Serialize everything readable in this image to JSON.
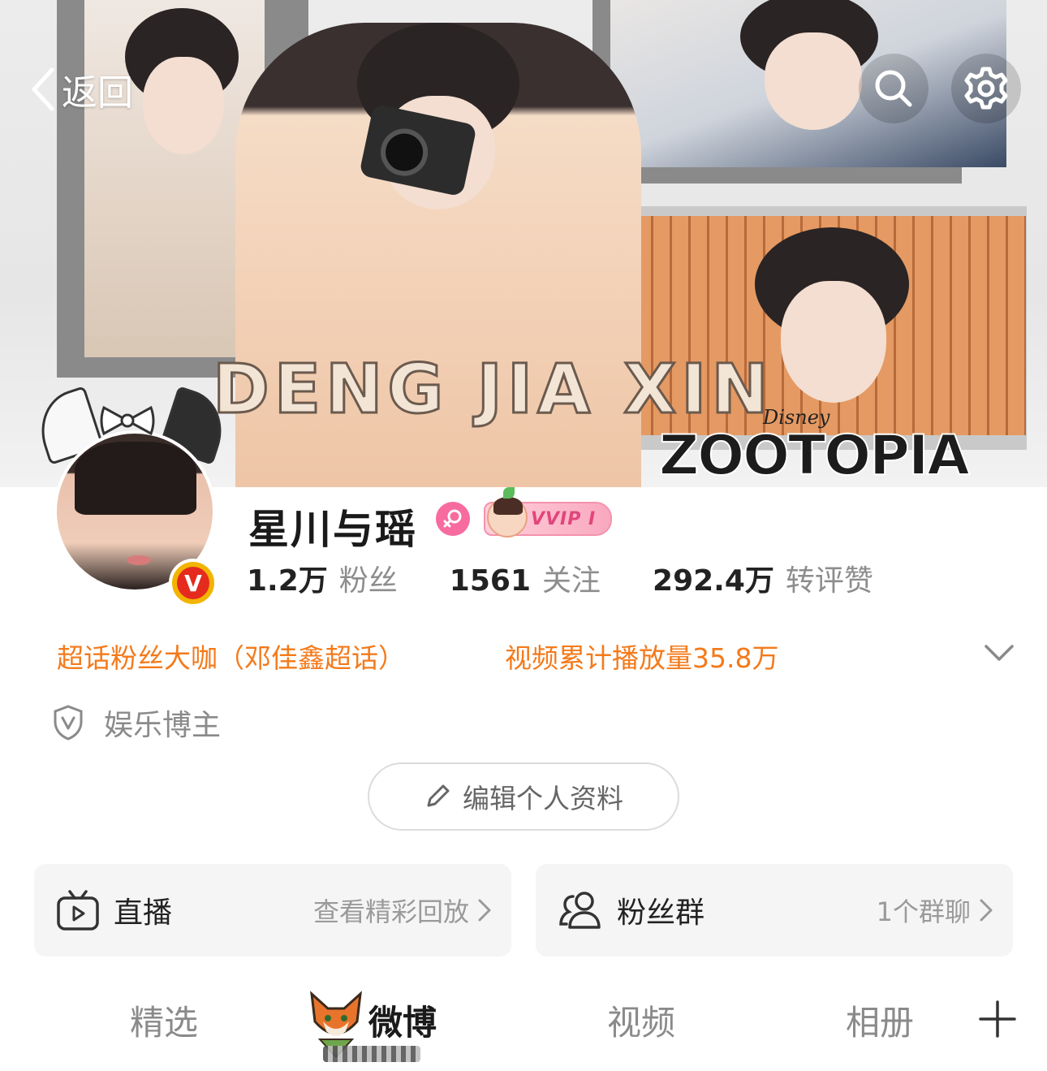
{
  "top_bar": {
    "back_label": "返回"
  },
  "cover": {
    "title_text": "DENG JIA XIN",
    "logo_small": "Disney",
    "logo_big": "ZOOTOPIA"
  },
  "profile": {
    "name": "星川与瑶",
    "gender": "female",
    "vip_badge": "VVIP I",
    "verified_badge": "V",
    "stats": [
      {
        "value": "1.2万",
        "label": "粉丝"
      },
      {
        "value": "1561",
        "label": "关注"
      },
      {
        "value": "292.4万",
        "label": "转评赞"
      }
    ],
    "tags": [
      "超话粉丝大咖（邓佳鑫超话）",
      "视频累计播放量35.8万"
    ],
    "category": "娱乐博主",
    "edit_button": "编辑个人资料"
  },
  "cards": {
    "live": {
      "title": "直播",
      "subtitle": "查看精彩回放"
    },
    "fans_group": {
      "title": "粉丝群",
      "subtitle": "1个群聊"
    }
  },
  "tabs": [
    {
      "label": "精选",
      "active": false
    },
    {
      "label": "微博",
      "active": true
    },
    {
      "label": "视频",
      "active": false
    },
    {
      "label": "相册",
      "active": false
    }
  ],
  "colors": {
    "accent_orange": "#f47a1b",
    "vip_pink": "#e2457c",
    "verified_red": "#e52a1e",
    "gender_pink": "#f76b9e"
  },
  "icons": [
    "chevron-left-icon",
    "search-icon",
    "gear-icon",
    "chevron-down-icon",
    "shield-v-icon",
    "pencil-icon",
    "tv-icon",
    "users-icon",
    "chevron-right-icon",
    "plus-icon"
  ]
}
